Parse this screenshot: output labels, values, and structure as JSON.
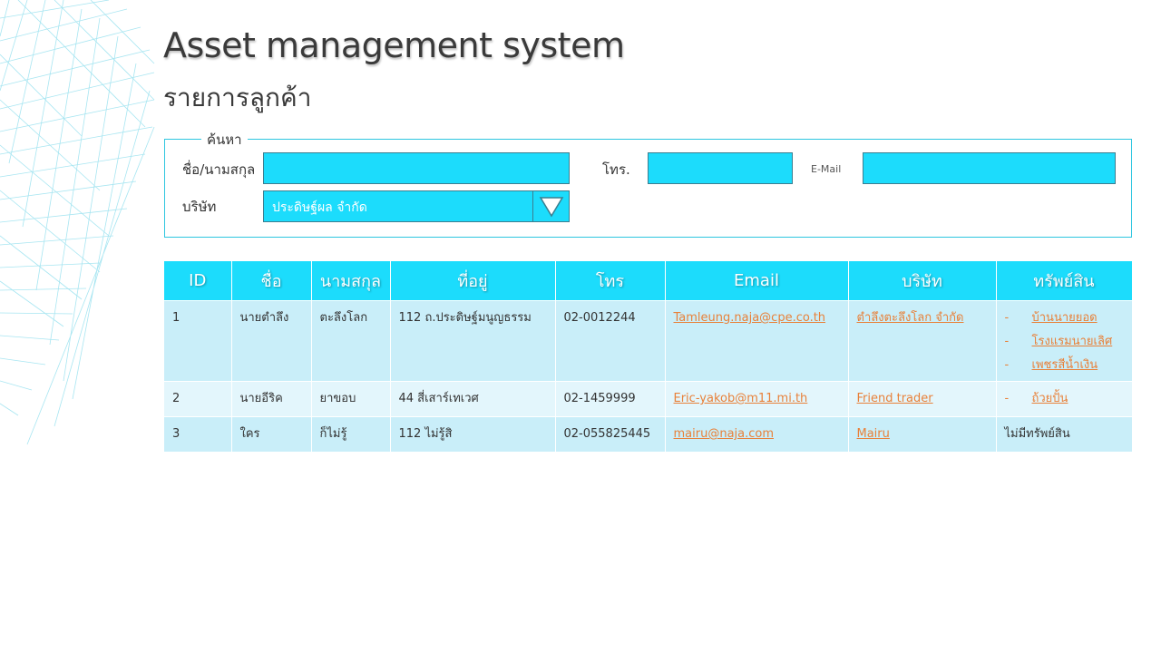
{
  "header": {
    "title": "Asset management system",
    "subtitle": "รายการลูกค้า"
  },
  "search": {
    "legend": "ค้นหา",
    "name_label": "ชื่อ/นามสกุล",
    "name_value": "",
    "phone_label": "โทร.",
    "phone_value": "",
    "email_label": "E-Mail",
    "email_value": "",
    "company_label": "บริษัท",
    "company_selected": "ประดิษฐ์ผล จำกัด",
    "field_color": "#1cdcfc"
  },
  "table": {
    "columns": [
      "ID",
      "ชื่อ",
      "นามสกุล",
      "ที่อยู่",
      "โทร",
      "Email",
      "บริษัท",
      "ทรัพย์สิน"
    ],
    "rows": [
      {
        "id": "1",
        "first_name": "นายตำลึง",
        "last_name": "ตะลึงโลก",
        "address": "112 ถ.ประดิษฐ์มนูญธรรม",
        "phone": "02-0012244",
        "email": "Tamleung.naja@cpe.co.th",
        "company": "ตำลึงตะลึงโลก จำกัด",
        "assets": [
          "บ้านนายยอด",
          "โรงแรมนายเลิศ",
          "เพชรสีน้ำเงิน"
        ]
      },
      {
        "id": "2",
        "first_name": "นายอีริค",
        "last_name": "ยาขอบ",
        "address": "44 สี่เสาร์เทเวศ",
        "phone": "02-1459999",
        "email": "Eric-yakob@m11.mi.th",
        "company": "Friend trader",
        "assets": [
          "ถ้วยปั้น"
        ]
      },
      {
        "id": "3",
        "first_name": "ใคร",
        "last_name": "ก็ไม่รู้",
        "address": "112 ไม่รู้สิ",
        "phone": "02-055825445",
        "email": "mairu@naja.com",
        "company": "Mairu",
        "no_assets": "ไม่มีทรัพย์สิน"
      }
    ],
    "asset_bullet": "-",
    "header_color": "#1cdcfc",
    "link_color": "#e8813a"
  }
}
